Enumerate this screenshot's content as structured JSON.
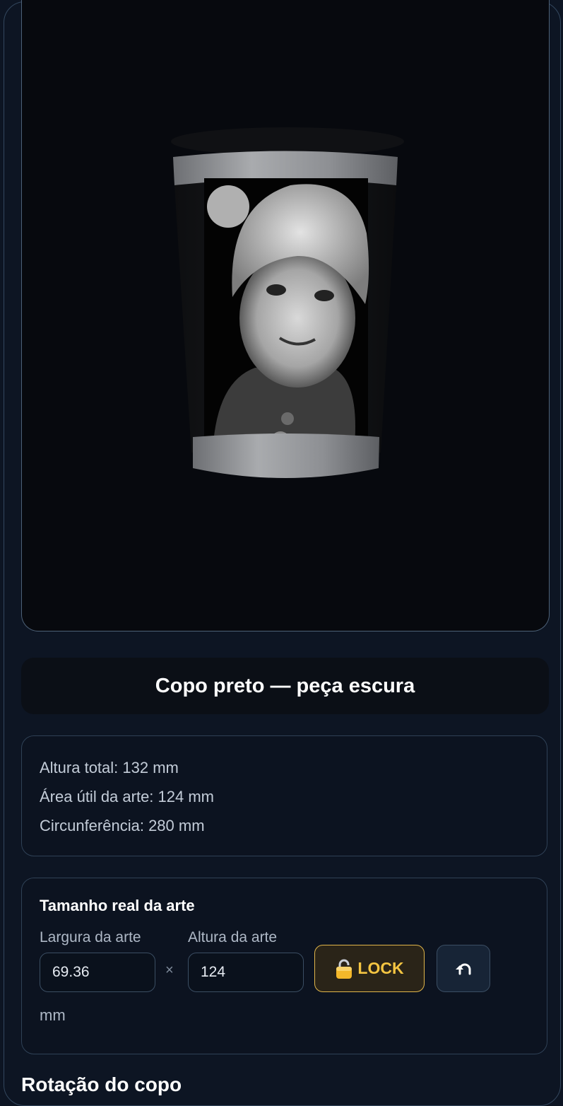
{
  "product": {
    "title": "Copo preto — peça escura"
  },
  "specs": {
    "total_height": "Altura total: 132 mm",
    "art_area": "Área útil da arte: 124 mm",
    "circumference": "Circunferência: 280 mm"
  },
  "art_size": {
    "title": "Tamanho real da arte",
    "width_label": "Largura da arte",
    "height_label": "Altura da arte",
    "width_value": "69.36",
    "height_value": "124",
    "separator": "×",
    "lock_label": "LOCK",
    "unit": "mm"
  },
  "next_section": {
    "title": "Rotação do copo"
  },
  "icons": {
    "lock": "padlock-icon",
    "reset": "undo-icon"
  },
  "colors": {
    "background": "#0d1523",
    "viewer": "#07090e",
    "accent": "#f4c542"
  }
}
